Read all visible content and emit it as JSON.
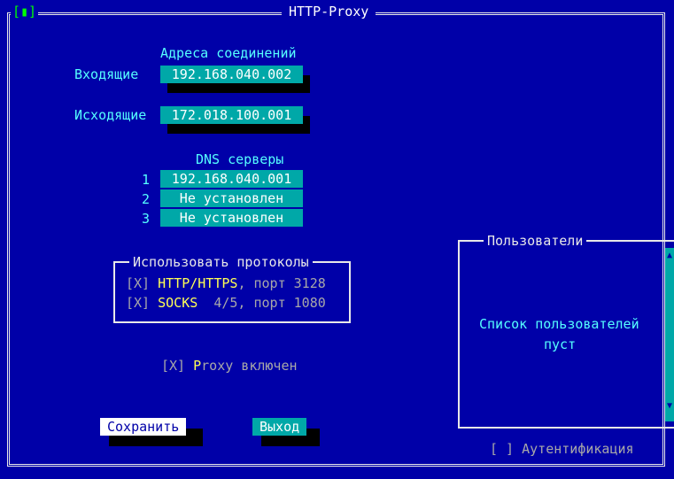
{
  "window": {
    "title": "HTTP-Proxy",
    "close_glyph": "[▮]"
  },
  "addresses": {
    "heading": "Адреса соединений",
    "incoming_label": "Входящие",
    "incoming_value": "192.168.040.002",
    "outgoing_label": "Исходящие",
    "outgoing_value": "172.018.100.001"
  },
  "dns": {
    "heading": "DNS серверы",
    "servers": [
      {
        "index": "1",
        "value": "192.168.040.001"
      },
      {
        "index": "2",
        "value": "Не установлен"
      },
      {
        "index": "3",
        "value": "Не установлен"
      }
    ]
  },
  "protocols": {
    "title": "Использовать протоколы",
    "items": [
      {
        "check": "[X]",
        "name": "HTTP/HTTPS",
        "rest": ", порт 3128"
      },
      {
        "check": "[X]",
        "name": "SOCKS",
        "rest": "  4/5, порт 1080"
      }
    ]
  },
  "proxy_enabled": {
    "check": "[X]",
    "hot": "P",
    "label": "roxy включен"
  },
  "users": {
    "title": "Пользователи",
    "empty_line1": "Список пользователей",
    "empty_line2": "пуст",
    "auth_check": "[ ]",
    "auth_label": "Аутентификация"
  },
  "buttons": {
    "save": "Сохранить",
    "exit": "Выход"
  },
  "colors": {
    "background": "#0000a8",
    "field": "#00a8a8",
    "accent": "#55ffff",
    "hotkey": "#ffff55"
  }
}
